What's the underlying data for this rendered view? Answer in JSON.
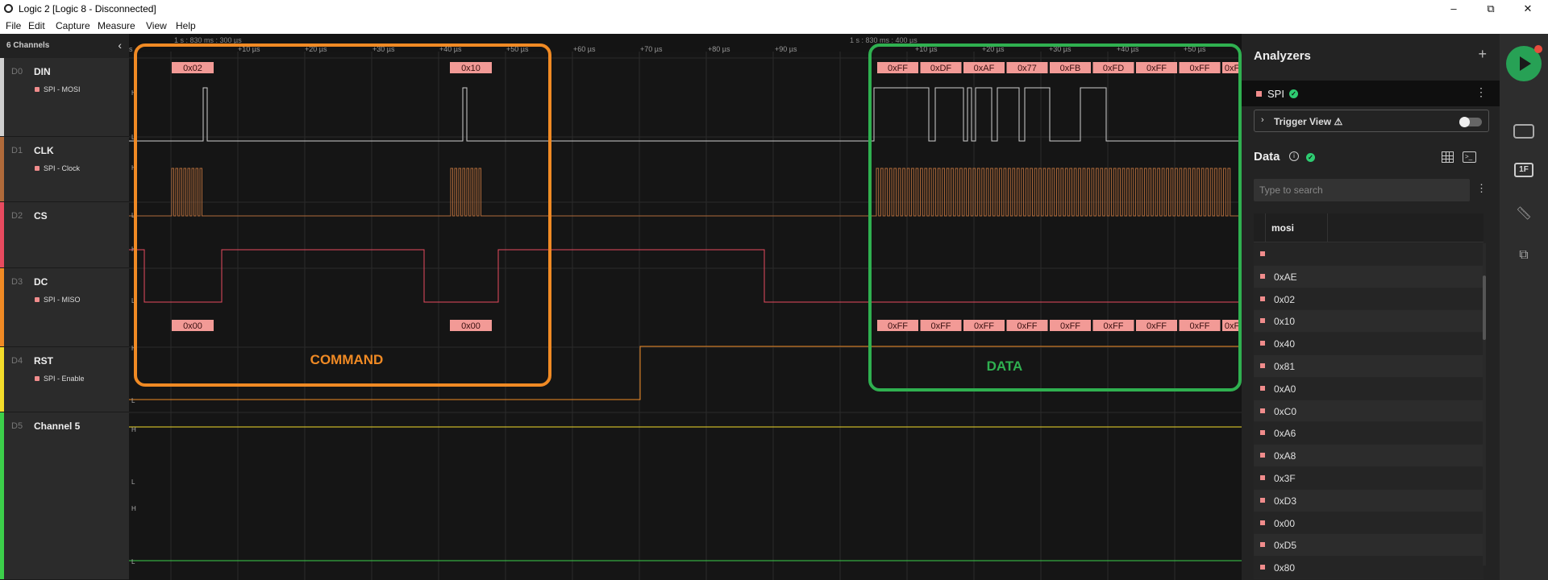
{
  "window": {
    "title": "Logic 2 [Logic 8 - Disconnected]",
    "minimize": "–",
    "maximize": "⧉",
    "close": "✕"
  },
  "menu": [
    "File",
    "Edit",
    "Capture",
    "Measure",
    "View",
    "Help"
  ],
  "channels": {
    "header": "6 Channels",
    "items": [
      {
        "index": "D0",
        "name": "DIN",
        "analyzer": "SPI - MOSI",
        "color": "#cfcfcf"
      },
      {
        "index": "D1",
        "name": "CLK",
        "analyzer": "SPI - Clock",
        "color": "#b06a3a"
      },
      {
        "index": "D2",
        "name": "CS",
        "analyzer": "",
        "color": "#e84a5f"
      },
      {
        "index": "D3",
        "name": "DC",
        "analyzer": "SPI - MISO",
        "color": "#f08a24"
      },
      {
        "index": "D4",
        "name": "RST",
        "analyzer": "SPI - Enable",
        "color": "#f3dc2a"
      },
      {
        "index": "D5",
        "name": "Channel 5",
        "analyzer": "",
        "color": "#3ccf4a"
      }
    ]
  },
  "timeline": {
    "left_ticks": [
      "s",
      "+10 µs",
      "+20 µs",
      "+30 µs",
      "+40 µs",
      "+50 µs",
      "+60 µs",
      "+70 µs",
      "+80 µs",
      "+90 µs"
    ],
    "left_origin": "1 s : 830 ms : 300 µs",
    "right_ticks": [
      "+10 µs",
      "+20 µs",
      "+30 µs",
      "+40 µs",
      "+50 µs"
    ],
    "right_origin": "1 s : 830 ms : 400 µs"
  },
  "decoded": {
    "mosi_left": [
      "0x02",
      "0x10"
    ],
    "miso_left": [
      "0x00",
      "0x00"
    ],
    "mosi_right": [
      "0xFF",
      "0xDF",
      "0xAF",
      "0x77",
      "0xFB",
      "0xFD",
      "0xFF",
      "0xFF",
      "0xF"
    ],
    "miso_right": [
      "0xFF",
      "0xFF",
      "0xFF",
      "0xFF",
      "0xFF",
      "0xFF",
      "0xFF",
      "0xFF",
      "0xF"
    ]
  },
  "annotations": {
    "command": {
      "text": "COMMAND",
      "color": "#f08a24"
    },
    "data": {
      "text": "DATA",
      "color": "#2fb050"
    }
  },
  "level_labels": {
    "high": "H",
    "low": "L"
  },
  "panel": {
    "title": "Analyzers",
    "add": "+",
    "analyzer_name": "SPI",
    "more": "⋮",
    "trigger_view": "Trigger View ⚠",
    "data_title": "Data",
    "search_placeholder": "Type to search",
    "column": "mosi",
    "rows": [
      "",
      "0xAE",
      "0x02",
      "0x10",
      "0x40",
      "0x81",
      "0xA0",
      "0xC0",
      "0xA6",
      "0xA8",
      "0x3F",
      "0xD3",
      "0x00",
      "0xD5",
      "0x80"
    ]
  },
  "rail": {
    "hex_label": "1F"
  }
}
